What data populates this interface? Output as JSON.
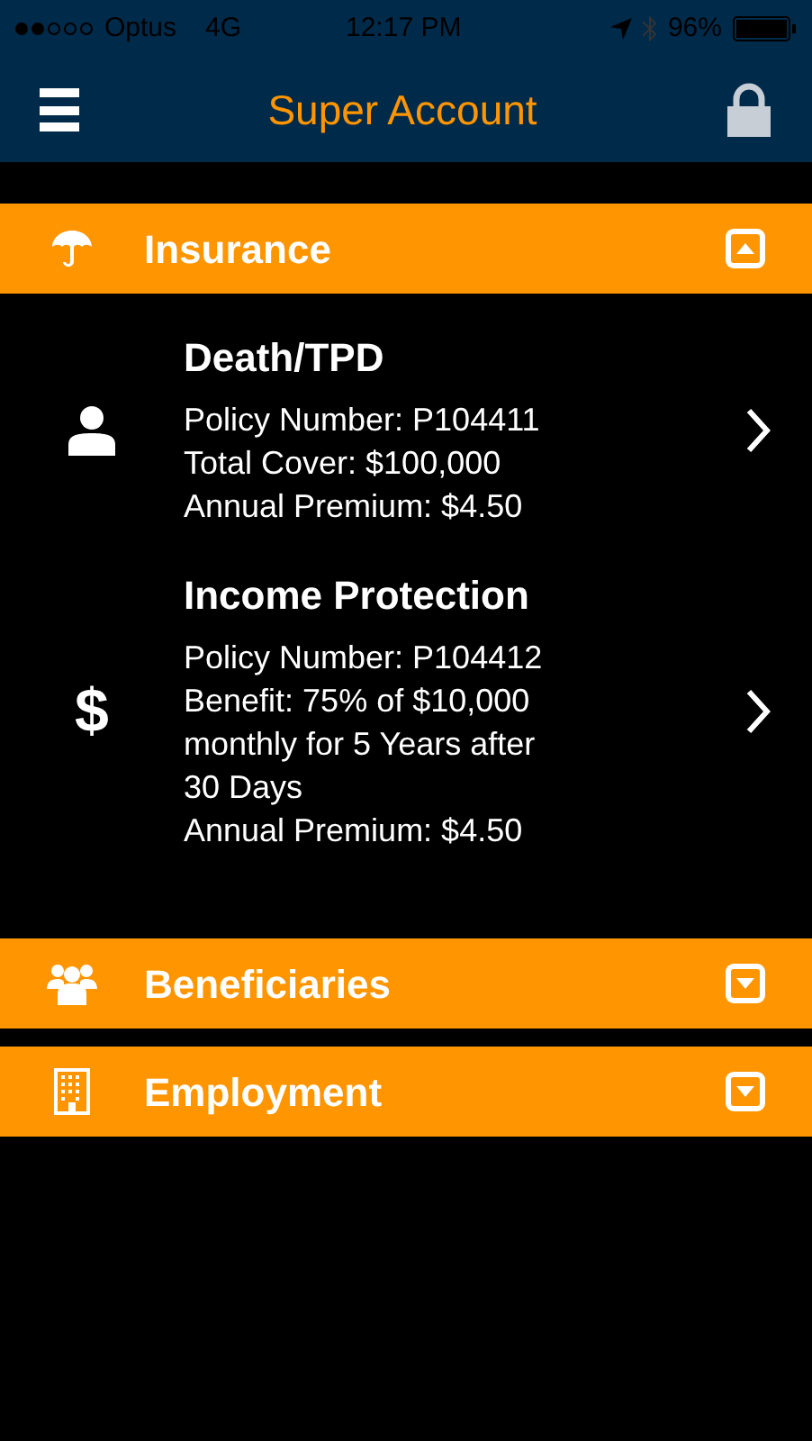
{
  "status_bar": {
    "carrier": "Optus",
    "network": "4G",
    "time": "12:17 PM",
    "battery": "96%"
  },
  "nav_bar": {
    "title": "Super Account"
  },
  "sections": [
    {
      "kind": "umbrella",
      "title": "Insurance",
      "expanded": true,
      "items": [
        {
          "kind": "person",
          "title": "Death/TPD",
          "lines": [
            "Policy Number: P104411",
            "Total Cover: $100,000",
            "Annual Premium: $4.50"
          ]
        },
        {
          "kind": "dollar",
          "symbol": "$",
          "title": "Income Protection",
          "lines": [
            "Policy Number: P104412",
            "Benefit: 75% of $10,000 monthly for 5 Years after 30 Days",
            "Annual Premium: $4.50"
          ]
        }
      ]
    },
    {
      "kind": "people",
      "title": "Beneficiaries",
      "expanded": false
    },
    {
      "kind": "building",
      "title": "Employment",
      "expanded": false
    }
  ]
}
